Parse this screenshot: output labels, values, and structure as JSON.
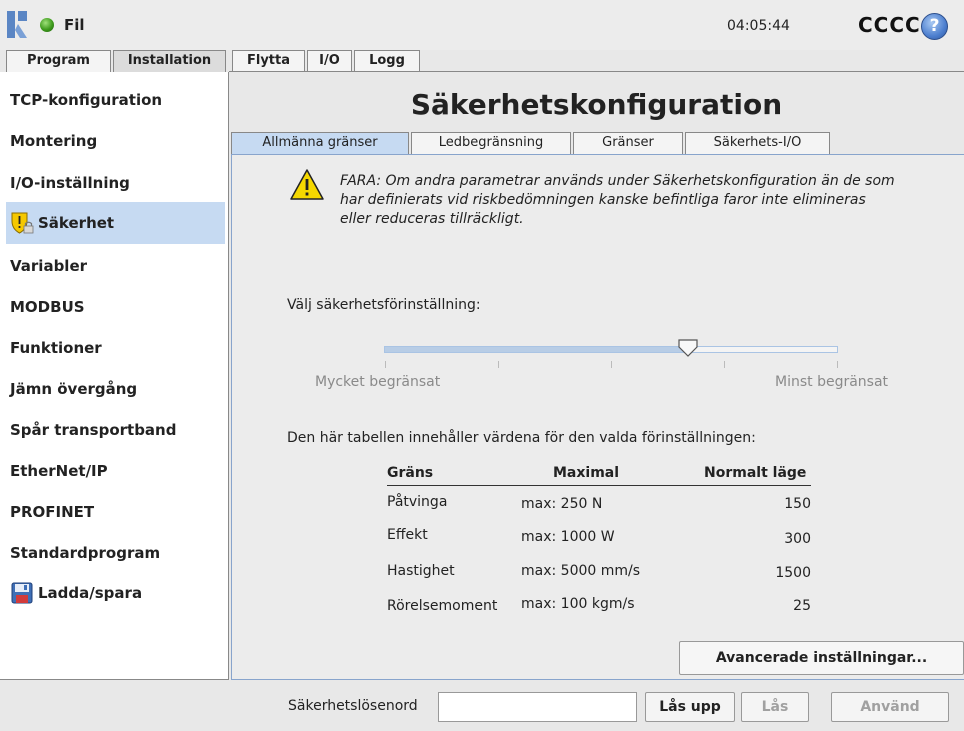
{
  "topbar": {
    "file_label": "Fil",
    "clock": "04:05:44",
    "robot_name": "CCCC",
    "help_glyph": "?"
  },
  "main_tabs": [
    "Program",
    "Installation",
    "Flytta",
    "I/O",
    "Logg"
  ],
  "sidebar": {
    "items": [
      {
        "label": "TCP-konfiguration"
      },
      {
        "label": "Montering"
      },
      {
        "label": "I/O-inställning"
      },
      {
        "label": "Säkerhet",
        "icon": "shield-lock-icon",
        "selected": true
      },
      {
        "label": "Variabler"
      },
      {
        "label": "MODBUS"
      },
      {
        "label": "Funktioner"
      },
      {
        "label": "Jämn övergång"
      },
      {
        "label": "Spår transportband"
      },
      {
        "label": "EtherNet/IP"
      },
      {
        "label": "PROFINET"
      },
      {
        "label": "Standardprogram"
      },
      {
        "label": "Ladda/spara",
        "icon": "floppy-disk-icon"
      }
    ]
  },
  "content": {
    "title": "Säkerhetskonfiguration",
    "subtabs": [
      "Allmänna gränser",
      "Ledbegränsning",
      "Gränser",
      "Säkerhets-I/O"
    ],
    "warning": "FARA: Om andra parametrar används under Säkerhetskonfiguration än de som har definierats vid riskbedömningen kanske befintliga faror inte elimineras eller reduceras tillräckligt.",
    "preset_label": "Välj säkerhetsförinställning:",
    "slider": {
      "min_label": "Mycket begränsat",
      "max_label": "Minst begränsat",
      "value_fraction": 0.67
    },
    "table_desc": "Den här tabellen innehåller värdena för den valda förinställningen:",
    "table": {
      "headers": [
        "Gräns",
        "Maximal",
        "Normalt läge"
      ],
      "rows": [
        {
          "name": "Påtvinga",
          "max": "max: 250 N",
          "normal": "150"
        },
        {
          "name": "Effekt",
          "max": "max: 1000 W",
          "normal": "300"
        },
        {
          "name": "Hastighet",
          "max": "max: 5000 mm/s",
          "normal": "1500"
        },
        {
          "name": "Rörelsemoment",
          "max": "max: 100 kgm/s",
          "normal": "25"
        }
      ]
    },
    "advanced_button": "Avancerade inställningar..."
  },
  "bottom": {
    "password_label": "Säkerhetslösenord",
    "password_value": "",
    "unlock": "Lås upp",
    "lock": "Lås",
    "apply": "Använd"
  },
  "colors": {
    "accent": "#c6daf2",
    "warning": "#f5d800"
  }
}
